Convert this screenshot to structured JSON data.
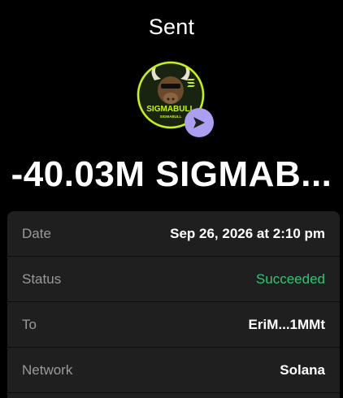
{
  "header": {
    "title": "Sent"
  },
  "token": {
    "logo_text": "SIGMABULL",
    "logo_subtext": "SIGMABULL",
    "icon": "send-arrow-icon"
  },
  "amount": "-40.03M SIGMAB...",
  "details": [
    {
      "label": "Date",
      "value": "Sep 26, 2026 at 2:10 pm",
      "style": "normal"
    },
    {
      "label": "Status",
      "value": "Succeeded",
      "style": "success"
    },
    {
      "label": "To",
      "value": "EriM...1MMt",
      "style": "normal"
    },
    {
      "label": "Network",
      "value": "Solana",
      "style": "normal"
    }
  ],
  "colors": {
    "background": "#000000",
    "panel": "#1f1f1f",
    "label": "#9a9a9a",
    "success": "#2ec775",
    "send_badge": "#ab9ff2",
    "logo_accent": "#c8f01e"
  }
}
